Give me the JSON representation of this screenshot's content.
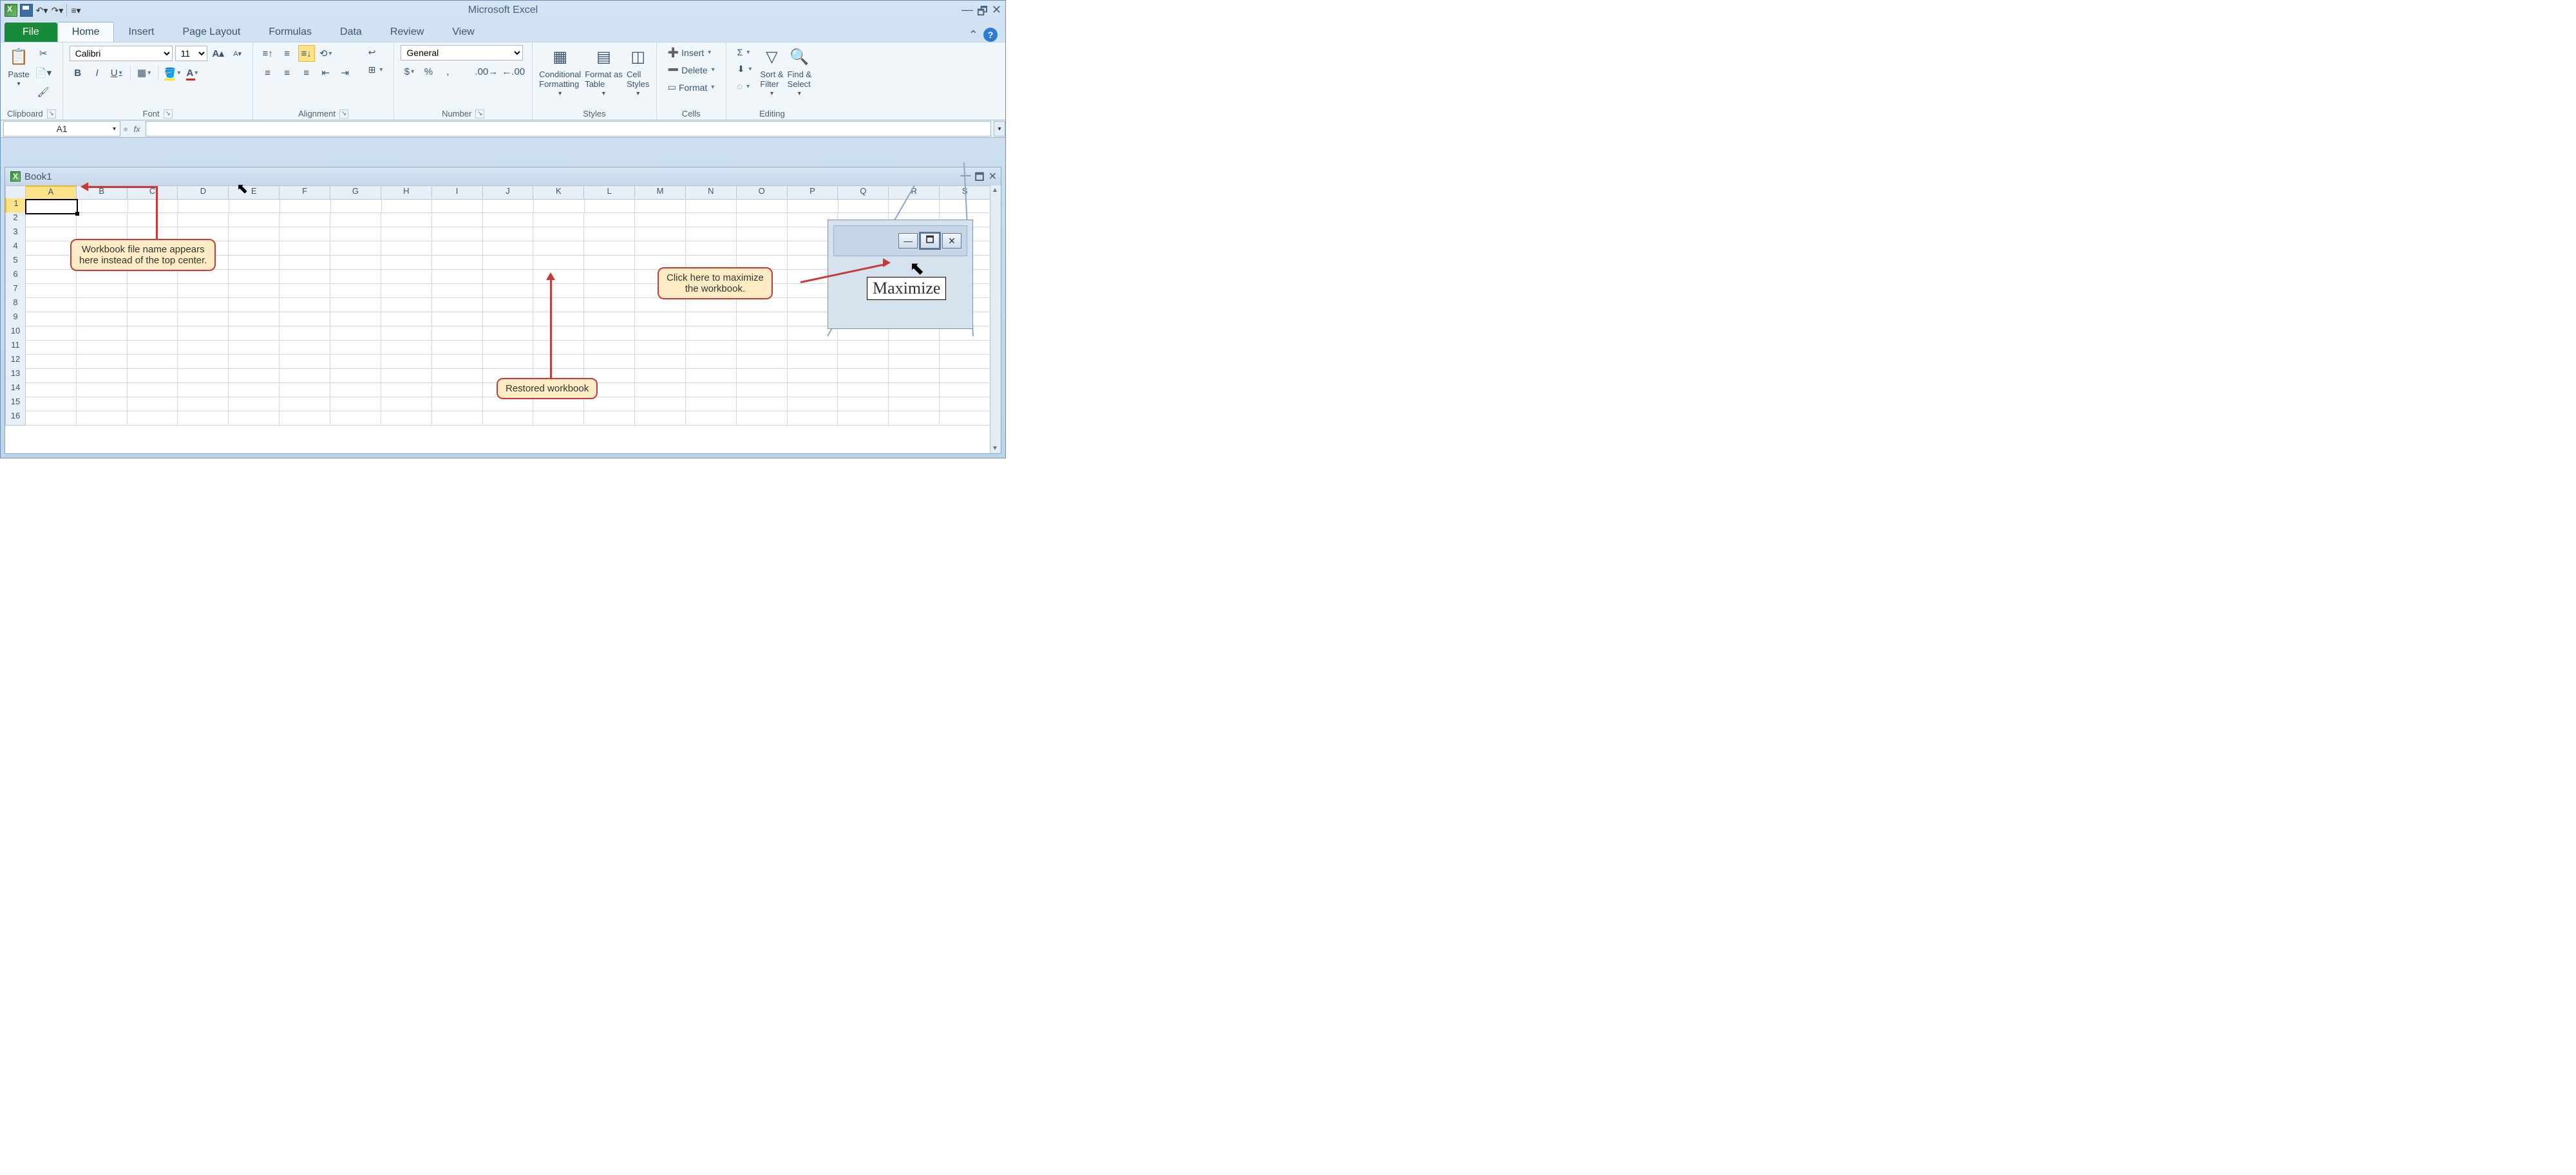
{
  "title": "Microsoft Excel",
  "file_tab": "File",
  "tabs": [
    "Home",
    "Insert",
    "Page Layout",
    "Formulas",
    "Data",
    "Review",
    "View"
  ],
  "active_tab": "Home",
  "groups": {
    "clipboard": "Clipboard",
    "font": "Font",
    "alignment": "Alignment",
    "number": "Number",
    "styles": "Styles",
    "cells": "Cells",
    "editing": "Editing"
  },
  "font": {
    "name": "Calibri",
    "size": "11"
  },
  "number_format": "General",
  "paste_label": "Paste",
  "styles_btns": {
    "cond": "Conditional\nFormatting",
    "table": "Format as\nTable",
    "cell": "Cell\nStyles"
  },
  "cells_btns": {
    "insert": "Insert",
    "delete": "Delete",
    "format": "Format"
  },
  "editing_btns": {
    "sort": "Sort &\nFilter",
    "find": "Find &\nSelect"
  },
  "namebox": "A1",
  "workbook_name": "Book1",
  "columns": [
    "A",
    "B",
    "C",
    "D",
    "E",
    "F",
    "G",
    "H",
    "I",
    "J",
    "K",
    "L",
    "M",
    "N",
    "O",
    "P",
    "Q",
    "R",
    "S"
  ],
  "rows": [
    "1",
    "2",
    "3",
    "4",
    "5",
    "6",
    "7",
    "8",
    "9",
    "10",
    "11",
    "12",
    "13",
    "14",
    "15",
    "16"
  ],
  "callout_filename": "Workbook file name appears\nhere instead of the top center.",
  "callout_restored": "Restored workbook",
  "callout_maximize": "Click here to maximize\nthe workbook.",
  "tooltip_maximize": "Maximize"
}
